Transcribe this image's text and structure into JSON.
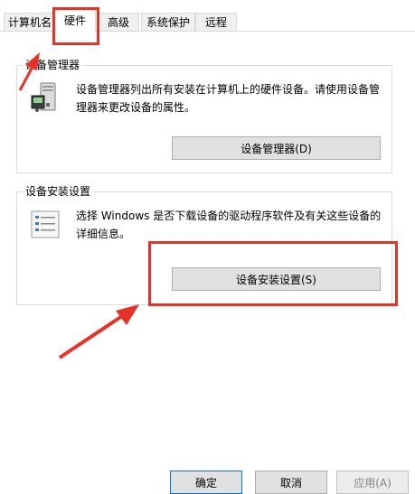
{
  "tabs": [
    {
      "label": "计算机名"
    },
    {
      "label": "硬件"
    },
    {
      "label": "高级"
    },
    {
      "label": "系统保护"
    },
    {
      "label": "远程"
    }
  ],
  "device_manager": {
    "title": "设备管理器",
    "description_line1": "设备管理器列出所有安装在计算机上的硬件设备。请使用设备管",
    "description_line2": "理器来更改设备的属性。",
    "button_label": "设备管理器(D)",
    "icon": "device-manager-icon"
  },
  "device_install": {
    "title": "设备安装设置",
    "description_line1": "选择 Windows 是否下载设备的驱动程序软件及有关这些设备的",
    "description_line2": "详细信息。",
    "button_label": "设备安装设置(S)",
    "icon": "checklist-icon"
  },
  "footer": {
    "ok_label": "确定",
    "cancel_label": "取消",
    "apply_label": "应用(A)"
  },
  "colors": {
    "annotation_red": "#e5332a",
    "button_face": "#e1e1e1"
  }
}
